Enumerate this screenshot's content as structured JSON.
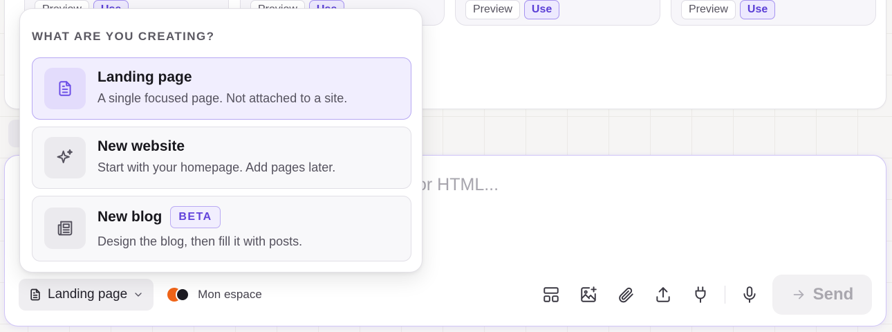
{
  "templates": {
    "cards": [
      {
        "preview_label": "Preview",
        "use_label": "Use"
      },
      {
        "preview_label": "Preview",
        "use_label": "Use"
      },
      {
        "preview_label": "Preview",
        "use_label": "Use"
      },
      {
        "preview_label": "Preview",
        "use_label": "Use"
      }
    ]
  },
  "composer": {
    "placeholder_fragment": "or HTML...",
    "mode_label": "Landing page",
    "workspace_name": "Mon espace",
    "send_label": "Send",
    "tool_icons": [
      "layout-icon",
      "image-plus-icon",
      "paperclip-icon",
      "upload-icon",
      "plug-icon",
      "microphone-icon"
    ]
  },
  "popover": {
    "heading": "WHAT ARE YOU CREATING?",
    "options": [
      {
        "title": "Landing page",
        "description": "A single focused page. Not attached to a site.",
        "icon": "document-icon",
        "selected": true
      },
      {
        "title": "New website",
        "description": "Start with your homepage. Add pages later.",
        "icon": "sparkles-icon",
        "selected": false
      },
      {
        "title": "New blog",
        "badge": "BETA",
        "description": "Design the blog, then fill it with posts.",
        "icon": "newspaper-icon",
        "selected": false
      }
    ]
  },
  "colors": {
    "accent": "#6b4de6",
    "accent_soft": "#f1eefe",
    "workspace_logo_orange": "#f06418"
  }
}
